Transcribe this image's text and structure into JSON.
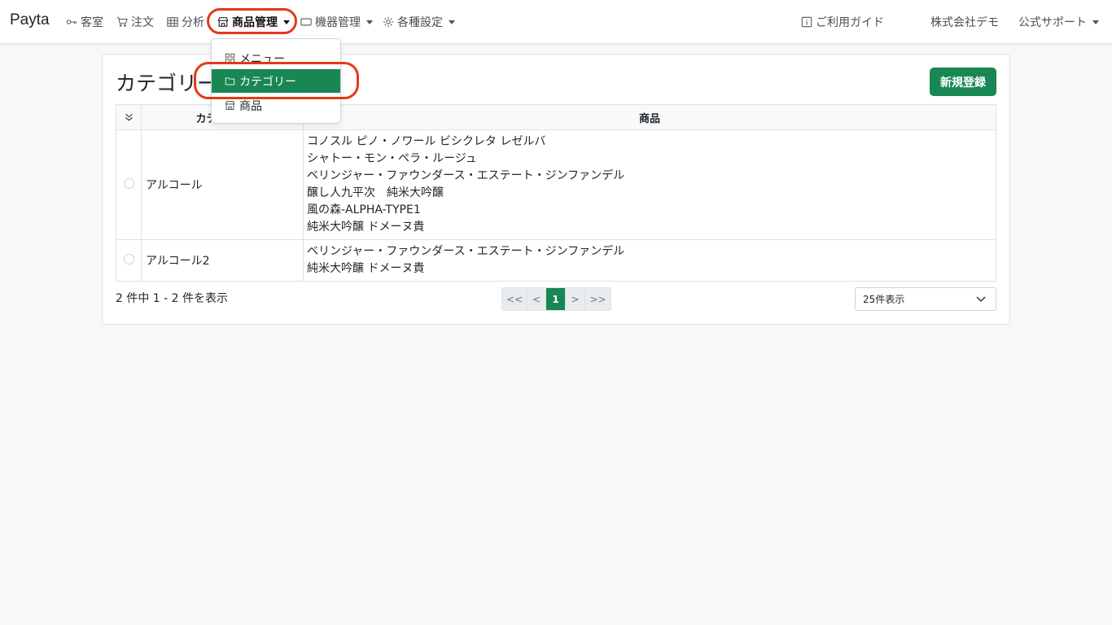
{
  "navbar": {
    "brand": "Payta",
    "items": [
      {
        "label": "客室",
        "icon": "key-icon"
      },
      {
        "label": "注文",
        "icon": "cart-icon"
      },
      {
        "label": "分析",
        "icon": "table-icon"
      },
      {
        "label": "商品管理",
        "icon": "shop-icon",
        "active": true
      },
      {
        "label": "機器管理",
        "icon": "device-icon"
      },
      {
        "label": "各種設定",
        "icon": "gear-icon"
      }
    ],
    "guide": "ご利用ガイド",
    "company": "株式会社デモ",
    "support": "公式サポート"
  },
  "dropdown": {
    "items": [
      {
        "label": "メニュー",
        "icon": "grid-icon"
      },
      {
        "label": "カテゴリー",
        "icon": "folder-icon",
        "selected": true
      },
      {
        "label": "商品",
        "icon": "shop-icon"
      }
    ]
  },
  "page": {
    "title": "カテゴリー",
    "new_button": "新規登録"
  },
  "table": {
    "headers": {
      "category": "カテゴリー",
      "products": "商品"
    },
    "rows": [
      {
        "category": "アルコール",
        "products": [
          "コノスル ピノ・ノワール ビシクレタ レゼルバ",
          "シャトー・モン・ペラ・ルージュ",
          "ベリンジャー・ファウンダース・エステート・ジンファンデル",
          "醸し人九平次　純米大吟醸",
          "風の森-ALPHA-TYPE1",
          "純米大吟醸 ドメーヌ貴"
        ]
      },
      {
        "category": "アルコール2",
        "products": [
          "ベリンジャー・ファウンダース・エステート・ジンファンデル",
          "純米大吟醸 ドメーヌ貴"
        ]
      }
    ]
  },
  "pagination": {
    "summary": "2 件中 1 - 2 件を表示",
    "first": "<<",
    "prev": "<",
    "current": "1",
    "next": ">",
    "last": ">>"
  },
  "per_page": {
    "selected": "25件表示"
  },
  "colors": {
    "primary": "#198754",
    "highlight": "#e23a16"
  }
}
